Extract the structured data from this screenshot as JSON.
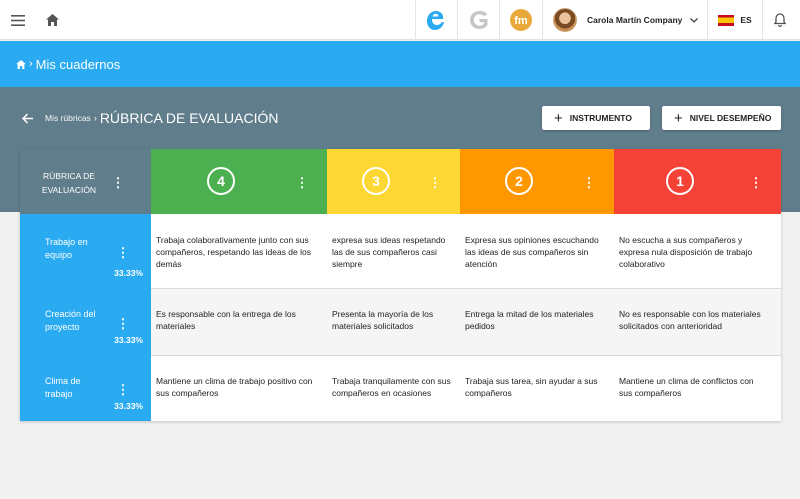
{
  "topbar": {
    "user_name": "Carola Martín Company",
    "language": "ES",
    "apps": [
      {
        "icon": "e-app-icon",
        "color": "#2aaaf0"
      },
      {
        "icon": "g-app-icon",
        "color": "#c7c7c7"
      },
      {
        "icon": "fm-app-icon",
        "label": "fm",
        "color": "#e9a93a"
      }
    ]
  },
  "breadcrumb": {
    "current": "Mis cuadernos"
  },
  "header": {
    "parent": "Mis rúbricas",
    "title": "RÚBRICA DE EVALUACIÓN",
    "btn_instrumento": "INSTRUMENTO",
    "btn_nivel": "NIVEL DESEMPEÑO"
  },
  "rubric": {
    "corner_label": "RÚBRICA DE EVALUACIÓN",
    "levels": [
      {
        "label": "4",
        "color": "#4caf50"
      },
      {
        "label": "3",
        "color": "#fdd835"
      },
      {
        "label": "2",
        "color": "#ff9800"
      },
      {
        "label": "1",
        "color": "#f44336"
      }
    ],
    "criteria": [
      {
        "name": "Trabajo en equipo",
        "weight": "33.33%",
        "descriptors": [
          "Trabaja colaborativamente junto con sus compañeros, respetando las ideas de los demás",
          "expresa sus ideas respetando las de sus compañeros casi siempre",
          "Expresa sus opiniones escuchando las ideas de sus compañeros sin atención",
          "No escucha a sus compañeros y expresa nula disposición de trabajo colaborativo"
        ]
      },
      {
        "name": "Creación del proyecto",
        "weight": "33.33%",
        "descriptors": [
          "Es responsable con la entrega de los materiales",
          "Presenta la mayoría de los materiales solicitados",
          "Entrega la mitad de los materiales pedidos",
          "No es responsable con los materiales solicitados con anterioridad"
        ]
      },
      {
        "name": "Clima de trabajo",
        "weight": "33.33%",
        "descriptors": [
          "Mantiene un clima de trabajo positivo con sus compañeros",
          "Trabaja tranquilamente con sus compañeros en ocasiones",
          "Trabaja sus tarea, sin ayudar a sus compañeros",
          "Mantiene un clima de conflictos con sus compañeros"
        ]
      }
    ]
  },
  "colors": {
    "primary_blue": "#2aaaf0",
    "header_slate": "#607d8b",
    "row_alt": "#f5f5f5"
  }
}
